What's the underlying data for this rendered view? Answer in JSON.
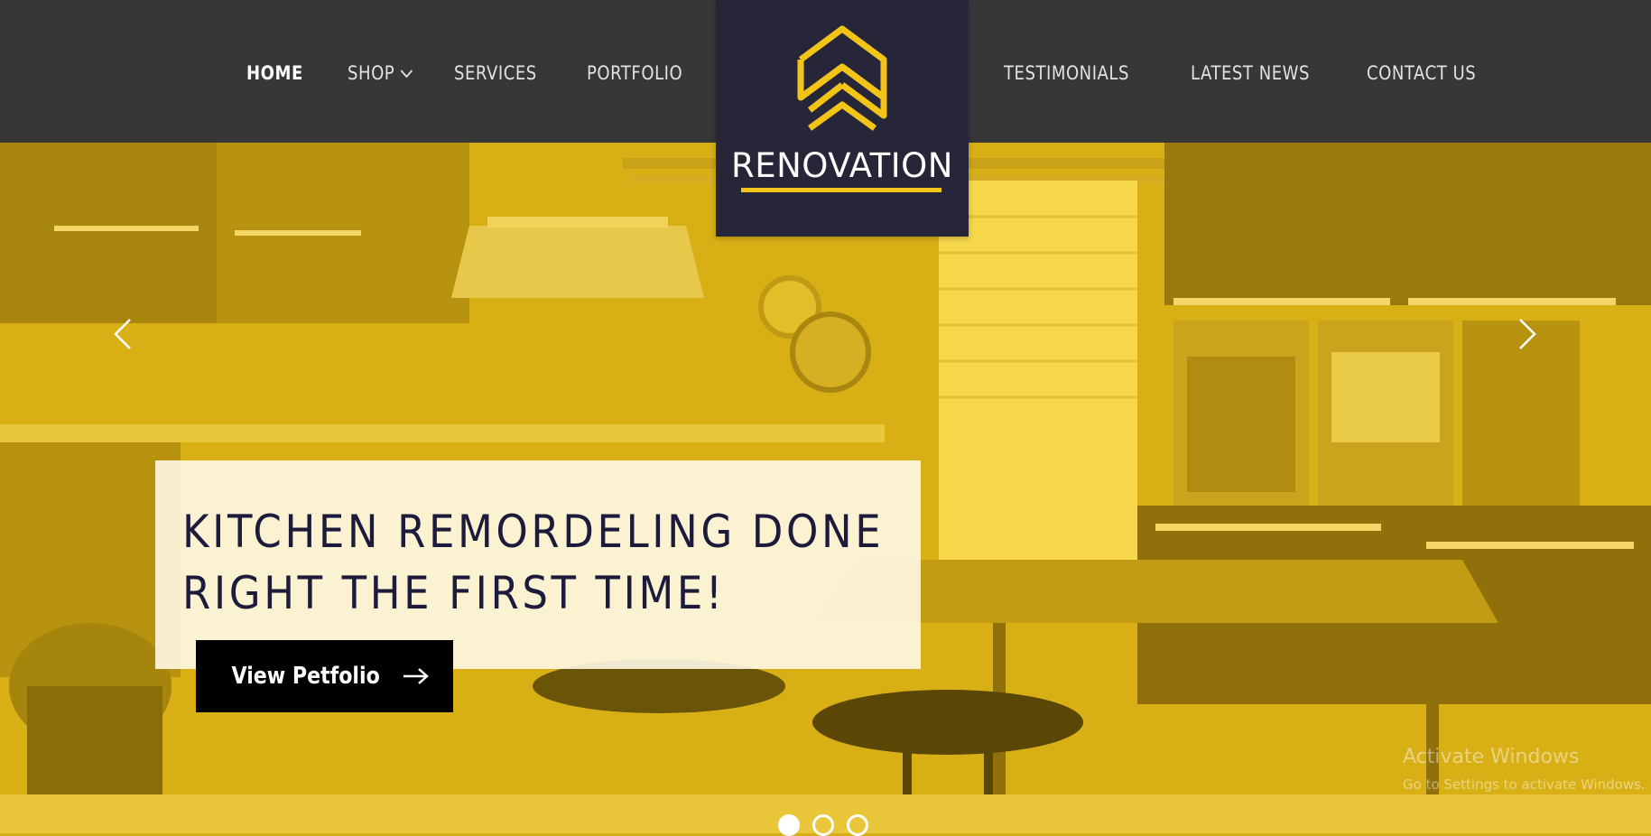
{
  "colors": {
    "nav_bg": "#373737",
    "logo_bg": "#272639",
    "accent_yellow": "#f2c418",
    "hero_tint": "#dcb416",
    "caption_text": "#1d1b3c",
    "cta_bg": "#000000"
  },
  "nav": {
    "items": [
      {
        "label": "HOME",
        "active": true
      },
      {
        "label": "SHOP",
        "has_dropdown": true
      },
      {
        "label": "SERVICES"
      },
      {
        "label": "PORTFOLIO"
      },
      {
        "label": "TESTIMONIALS"
      },
      {
        "label": "LATEST NEWS"
      },
      {
        "label": "CONTACT US"
      }
    ]
  },
  "logo": {
    "text": "RENOVATION",
    "icon": "double-chevron-up-icon"
  },
  "hero": {
    "headline_line1": "KITCHEN REMORDELING DONE",
    "headline_line2": "RIGHT THE FIRST TIME!",
    "cta_label": "View Petfolio",
    "cta_icon": "arrow-right-icon",
    "prev_icon": "chevron-left-icon",
    "next_icon": "chevron-right-icon",
    "slides_total": 3,
    "active_slide": 1
  },
  "watermark": {
    "title": "Activate Windows",
    "subtitle": "Go to Settings to activate Windows."
  }
}
